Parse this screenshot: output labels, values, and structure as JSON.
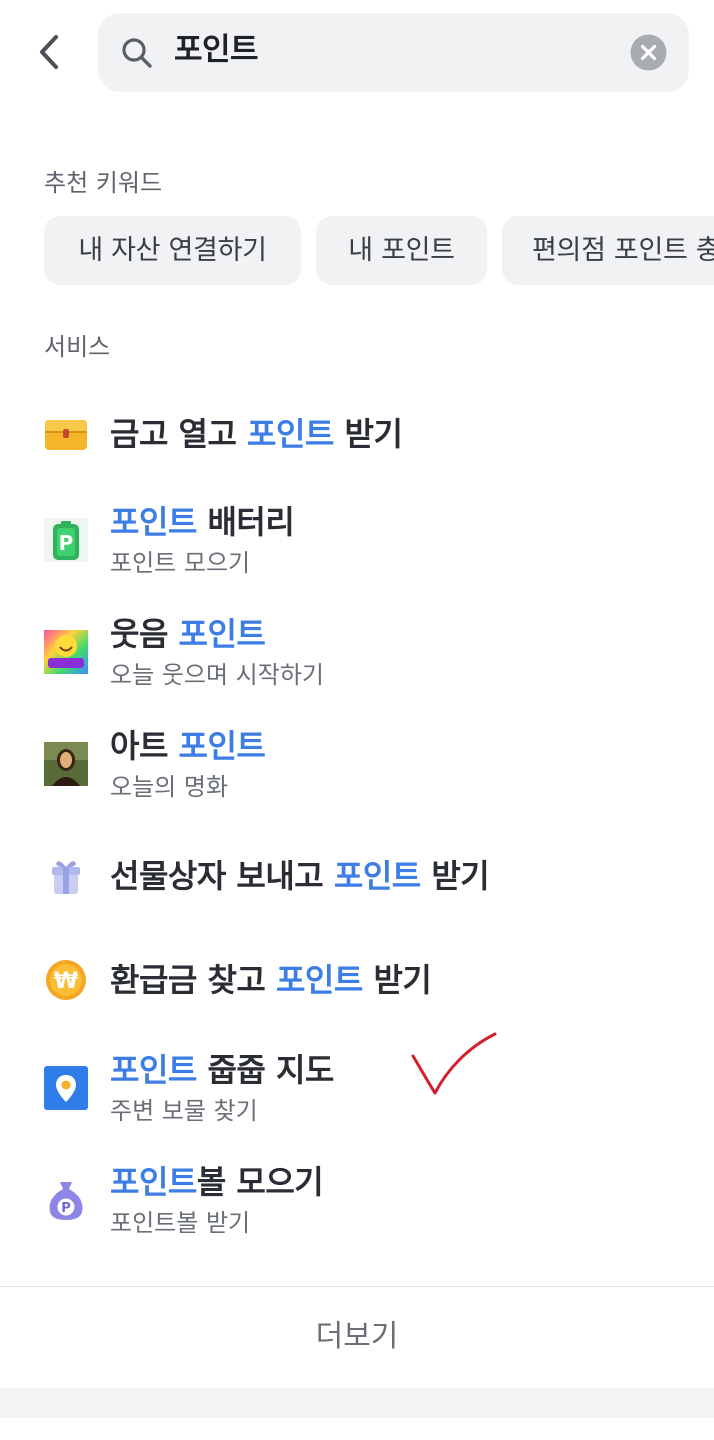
{
  "header": {
    "search_query": "포인트",
    "back_icon": "chevron-left-icon",
    "search_icon": "search-icon",
    "clear_icon": "clear-circle-icon"
  },
  "recommended": {
    "label": "추천 키워드",
    "chips": [
      "내 자산 연결하기",
      "내 포인트",
      "편의점 포인트 충"
    ]
  },
  "services": {
    "label": "서비스",
    "items": [
      {
        "pre": "금고 열고 ",
        "highlight": "포인트",
        "post": " 받기",
        "subtitle": "",
        "icon": "treasure-chest-icon"
      },
      {
        "pre": "",
        "highlight": "포인트",
        "post": " 배터리",
        "subtitle": "포인트 모으기",
        "icon": "battery-icon"
      },
      {
        "pre": "웃음 ",
        "highlight": "포인트",
        "post": "",
        "subtitle": "오늘 웃으며 시작하기",
        "icon": "smile-point-icon"
      },
      {
        "pre": "아트 ",
        "highlight": "포인트",
        "post": "",
        "subtitle": "오늘의 명화",
        "icon": "art-painting-icon"
      },
      {
        "pre": "선물상자 보내고 ",
        "highlight": "포인트",
        "post": " 받기",
        "subtitle": "",
        "icon": "gift-box-icon"
      },
      {
        "pre": "환급금 찾고 ",
        "highlight": "포인트",
        "post": " 받기",
        "subtitle": "",
        "icon": "won-coin-icon"
      },
      {
        "pre": "",
        "highlight": "포인트",
        "post": " 줍줍 지도",
        "subtitle": "주변 보물 찾기",
        "icon": "map-pin-icon"
      },
      {
        "pre": "",
        "highlight": "포인트",
        "post": "볼 모으기",
        "subtitle": "포인트볼 받기",
        "icon": "money-bag-icon"
      }
    ]
  },
  "more_label": "더보기",
  "colors": {
    "highlight": "#3c7de6",
    "annotation": "#d4202a"
  }
}
